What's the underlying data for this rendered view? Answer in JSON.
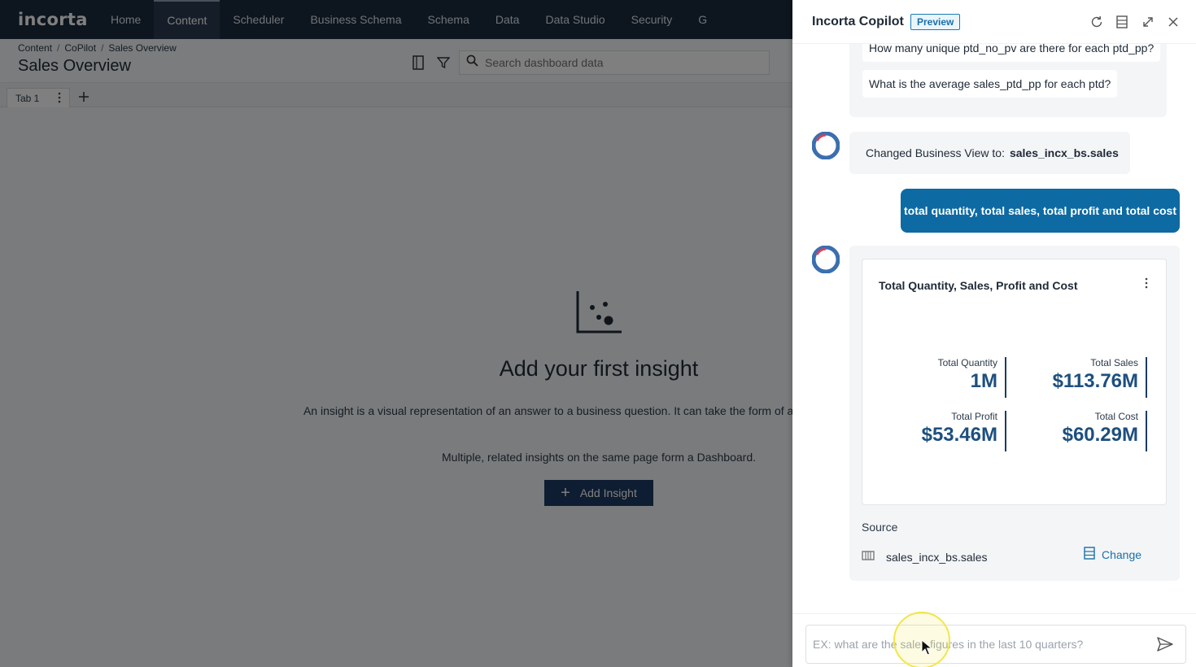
{
  "app": {
    "logo": "incorta",
    "nav": [
      {
        "label": "Home"
      },
      {
        "label": "Content",
        "active": true
      },
      {
        "label": "Scheduler"
      },
      {
        "label": "Business Schema"
      },
      {
        "label": "Schema"
      },
      {
        "label": "Data"
      },
      {
        "label": "Data Studio"
      },
      {
        "label": "Security"
      },
      {
        "label": "G"
      }
    ]
  },
  "dashboard": {
    "breadcrumb": [
      "Content",
      "CoPilot",
      "Sales Overview"
    ],
    "title": "Sales Overview",
    "search_placeholder": "Search dashboard data",
    "tabs": [
      {
        "label": "Tab 1"
      }
    ],
    "empty_state": {
      "title": "Add your first insight",
      "description": "An insight is a visual representation of an answer to a business question. It can take the form of a chart, table, or KPI.",
      "description2": "Multiple, related insights on the same page form a Dashboard.",
      "button": "Add Insight"
    }
  },
  "copilot": {
    "title": "Incorta Copilot",
    "badge": "Preview",
    "suggestions": [
      "How many unique ptd_no_pv are there for each ptd_pp?",
      "What is the average sales_ptd_pp for each ptd?"
    ],
    "bot_message": {
      "prefix": "Changed Business View to:",
      "value": "sales_incx_bs.sales"
    },
    "user_message": "total quantity, total sales, total profit and total cost",
    "result": {
      "title": "Total Quantity, Sales, Profit and Cost",
      "kpis": [
        {
          "label": "Total Quantity",
          "value": "1M"
        },
        {
          "label": "Total Sales",
          "value": "$113.76M"
        },
        {
          "label": "Total Profit",
          "value": "$53.46M"
        },
        {
          "label": "Total Cost",
          "value": "$60.29M"
        }
      ],
      "source_label": "Source",
      "source_name": "sales_incx_bs.sales",
      "change_label": "Change"
    },
    "input_placeholder": "EX: what are the sales figures in the last 10 quarters?"
  },
  "colors": {
    "nav_bg": "#1b2a3d",
    "primary": "#1d3b63",
    "user_bubble": "#0d6aa3",
    "kpi_value": "#1d4f7f",
    "link": "#1a6fa8"
  }
}
